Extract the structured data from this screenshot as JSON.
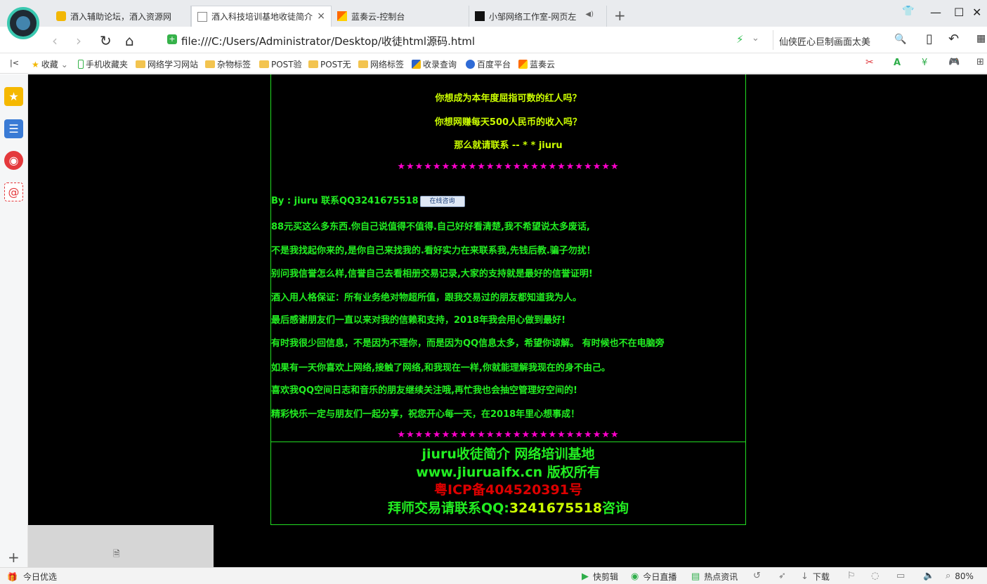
{
  "tabs": [
    {
      "title": "酒入辅助论坛，酒入资源网",
      "icon": "trophy-icon"
    },
    {
      "title": "酒入科技培训基地收徒简介",
      "icon": "page-icon",
      "active": true
    },
    {
      "title": "蓝奏云-控制台",
      "icon": "lanzou-icon"
    },
    {
      "title": "小邹网络工作室-网页左",
      "icon": "black-square-icon"
    }
  ],
  "tab_close": "×",
  "tab_add": "+",
  "audio_glyph": "◀)",
  "window": {
    "min": "—",
    "max": "☐",
    "close": "✕",
    "shirt": "👕"
  },
  "nav": {
    "back": "‹",
    "forward": "›",
    "reload": "↻",
    "home": "⌂"
  },
  "address": {
    "url": "file:///C:/Users/Administrator/Desktop/收徒html源码.html",
    "bolt": "⚡",
    "chevron": "⌄"
  },
  "search": {
    "text": "仙侠匠心巨制画面太美",
    "icon": "🔍"
  },
  "nav_right": {
    "phone": "▯",
    "undo": "↶",
    "grid": "▦"
  },
  "bookmarks": {
    "collapse": "|<",
    "items": [
      {
        "label": "收藏",
        "type": "star"
      },
      {
        "label": "手机收藏夹",
        "type": "phone"
      },
      {
        "label": "网络学习网站",
        "type": "folder"
      },
      {
        "label": "杂物标签",
        "type": "folder"
      },
      {
        "label": "POST验",
        "type": "folder"
      },
      {
        "label": "POST无",
        "type": "folder"
      },
      {
        "label": "网络标签",
        "type": "folder"
      },
      {
        "label": "收录查询",
        "type": "site"
      },
      {
        "label": "百度平台",
        "type": "baidu"
      },
      {
        "label": "蓝奏云",
        "type": "lanzou"
      }
    ],
    "tools": [
      "✂",
      "A",
      "¥",
      "🎮",
      "⊞"
    ]
  },
  "sidebar": {
    "plus": "+"
  },
  "page": {
    "top_lines": [
      "你想成为本年度屈指可数的红人吗？",
      "你想网赚每天500人民币的收入吗？",
      "那么就请联系 -- * * jiuru"
    ],
    "stars": "★★★★★★★★★★★★★★★★★★★★★★★★★",
    "by_line": "By : jiuru 联系QQ3241675518",
    "consult_btn": "在线咨询",
    "paragraphs": [
      "88元买这么多东西.你自己说值得不值得.自己好好看清楚,我不希望说太多废话,",
      "不是我找起你来的,是你自己来找我的.看好实力在来联系我,先钱后教.骗子勿扰！",
      "别问我信誉怎么样,信誉自己去看相册交易记录,大家的支持就是最好的信誉证明!",
      "酒入用人格保证：所有业务绝对物超所值，跟我交易过的朋友都知道我为人。",
      "最后感谢朋友们一直以来对我的信赖和支持，2018年我会用心做到最好!",
      "有时我很少回信息，不是因为不理你，而是因为QQ信息太多，希望你谅解。 有时候也不在电脑旁",
      "如果有一天你喜欢上网络,接触了网络,和我现在一样,你就能理解我现在的身不由己。",
      "喜欢我QQ空间日志和音乐的朋友继续关注哦,再忙我也会抽空管理好空间的!",
      "精彩快乐一定与朋友们一起分享，祝您开心每一天，在2018年里心想事成！"
    ],
    "footer": {
      "line1": "jiuru收徒简介 网络培训基地",
      "line2": "www.jiuruaifx.cn 版权所有",
      "icp": "粤ICP备404520391号",
      "contact_prefix": "拜师交易请联系QQ:",
      "contact_qq": "3241675518",
      "contact_suffix": "咨询"
    },
    "colors": {
      "yellow": "#ccff00",
      "green": "#22ee22",
      "magenta": "#ff00cc",
      "red": "#dd0000",
      "border": "#22dd22"
    }
  },
  "status": {
    "left": "今日优选",
    "items": [
      "快剪辑",
      "今日直播",
      "热点资讯"
    ],
    "download": "下载",
    "zoom": "80%"
  }
}
